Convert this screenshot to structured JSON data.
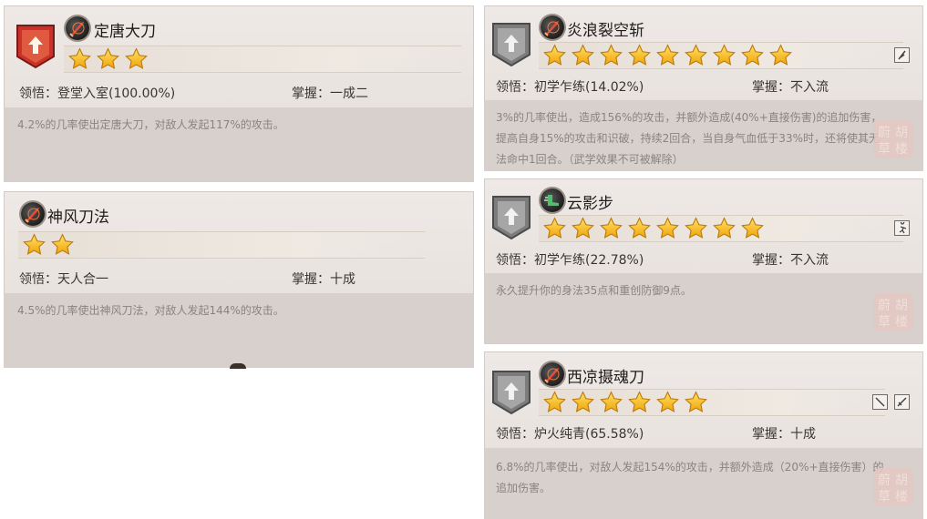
{
  "labels": {
    "comprehension": "领悟：",
    "mastery": "掌握："
  },
  "cards": [
    {
      "name": "定唐大刀",
      "stars": 3,
      "comprehension": "登堂入室(100.00%)",
      "mastery": "一成二",
      "description": "4.2%的几率使出定唐大刀，对敌人发起117%的攻击。",
      "shield": "red",
      "icon": "sword-icon"
    },
    {
      "name": "神风刀法",
      "stars": 2,
      "comprehension": "天人合一",
      "mastery": "十成",
      "description": "4.5%的几率使出神风刀法，对敌人发起144%的攻击。",
      "shield": "none",
      "icon": "sword-icon"
    },
    {
      "name": "炎浪裂空斩",
      "stars": 9,
      "comprehension": "初学乍练(14.02%)",
      "mastery": "不入流",
      "description_lines": [
        "3%的几率使出，造成156%的攻击，并额外造成(40%+直接伤害)的追加伤害，",
        "提高自身15%的攻击和识破，持续2回合，当自身气血低于33%时，还将使其无",
        "法命中1回合。（武学效果不可被解除）"
      ],
      "shield": "gray",
      "icon": "sword-icon"
    },
    {
      "name": "云影步",
      "stars": 8,
      "comprehension": "初学乍练(22.78%)",
      "mastery": "不入流",
      "description": "永久提升你的身法35点和重创防御9点。",
      "shield": "gray",
      "icon": "boot-icon"
    },
    {
      "name": "西凉摄魂刀",
      "stars": 6,
      "comprehension": "炉火纯青(65.58%)",
      "mastery": "十成",
      "description_lines": [
        "6.8%的几率使出，对敌人发起154%的攻击，并额外造成（20%+直接伤害）的",
        "追加伤害。"
      ],
      "shield": "gray",
      "icon": "sword-icon"
    }
  ],
  "seal_text": [
    "蔚",
    "胡",
    "草",
    "楼"
  ],
  "colors": {
    "star": "#f2b514",
    "shield_red": "#c8322a",
    "shield_gray": "#8c8c8c"
  }
}
